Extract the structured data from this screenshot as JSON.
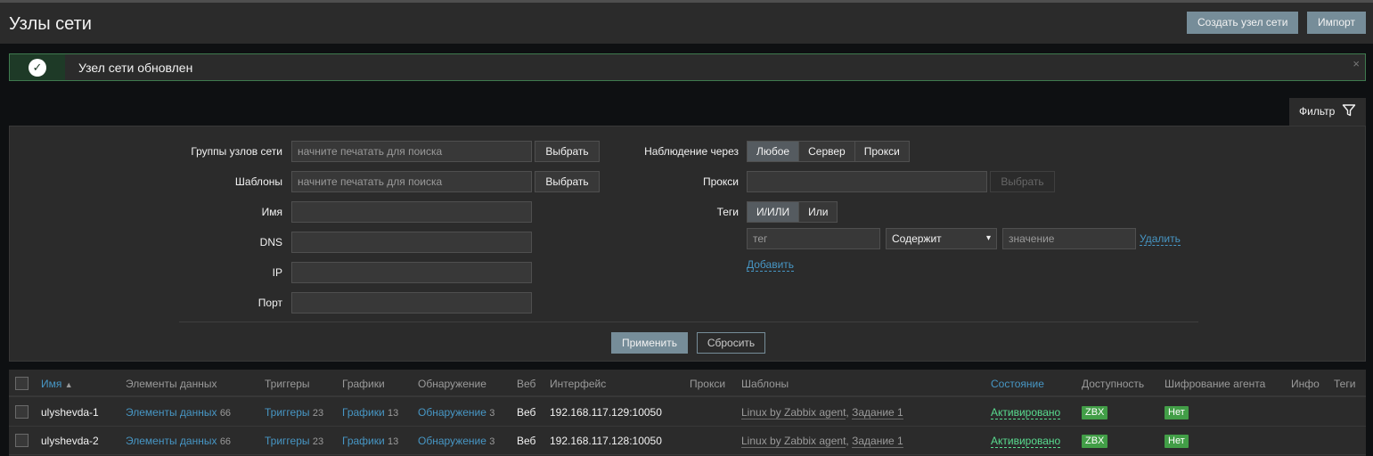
{
  "page": {
    "title": "Узлы сети",
    "create_button": "Создать узел сети",
    "import_button": "Импорт"
  },
  "message": {
    "text": "Узел сети обновлен",
    "icon": "check-circle-icon",
    "close": "×"
  },
  "filter": {
    "tab_label": "Фильтр",
    "host_groups": {
      "label": "Группы узлов сети",
      "placeholder": "начните печатать для поиска",
      "select": "Выбрать"
    },
    "templates": {
      "label": "Шаблоны",
      "placeholder": "начните печатать для поиска",
      "select": "Выбрать"
    },
    "name": {
      "label": "Имя",
      "value": ""
    },
    "dns": {
      "label": "DNS",
      "value": ""
    },
    "ip": {
      "label": "IP",
      "value": ""
    },
    "port": {
      "label": "Порт",
      "value": ""
    },
    "monitored_by": {
      "label": "Наблюдение через",
      "options": [
        "Любое",
        "Сервер",
        "Прокси"
      ],
      "selected": "Любое"
    },
    "proxy": {
      "label": "Прокси",
      "value": "",
      "select": "Выбрать"
    },
    "tags": {
      "label": "Теги",
      "options": [
        "И/ИЛИ",
        "Или"
      ],
      "selected": "И/ИЛИ",
      "tag_placeholder": "тег",
      "operator": "Содержит",
      "value_placeholder": "значение",
      "remove": "Удалить",
      "add": "Добавить"
    },
    "apply": "Применить",
    "reset": "Сбросить"
  },
  "table": {
    "columns": {
      "name": "Имя",
      "items": "Элементы данных",
      "triggers": "Триггеры",
      "graphs": "Графики",
      "discovery": "Обнаружение",
      "web": "Веб",
      "interface": "Интерфейс",
      "proxy": "Прокси",
      "templates": "Шаблоны",
      "status": "Состояние",
      "availability": "Доступность",
      "encryption": "Шифрование агента",
      "info": "Инфо",
      "tags": "Теги"
    },
    "rows": [
      {
        "name": "ulyshevda-1",
        "items": "Элементы данных",
        "items_count": "66",
        "triggers": "Триггеры",
        "triggers_count": "23",
        "graphs": "Графики",
        "graphs_count": "13",
        "discovery": "Обнаружение",
        "discovery_count": "3",
        "web": "Веб",
        "interface": "192.168.117.129:10050",
        "template_1": "Linux by Zabbix agent",
        "template_sep": ",",
        "template_2": "Задание 1",
        "status": "Активировано",
        "availability": "ZBX",
        "encryption": "Нет"
      },
      {
        "name": "ulyshevda-2",
        "items": "Элементы данных",
        "items_count": "66",
        "triggers": "Триггеры",
        "triggers_count": "23",
        "graphs": "Графики",
        "graphs_count": "13",
        "discovery": "Обнаружение",
        "discovery_count": "3",
        "web": "Веб",
        "interface": "192.168.117.128:10050",
        "template_1": "Linux by Zabbix agent",
        "template_sep": ",",
        "template_2": "Задание 1",
        "status": "Активировано",
        "availability": "ZBX",
        "encryption": "Нет"
      }
    ]
  },
  "colors": {
    "accent": "#768d99",
    "link": "#4796c4",
    "success": "#429e47",
    "status_enabled": "#59db8f"
  }
}
